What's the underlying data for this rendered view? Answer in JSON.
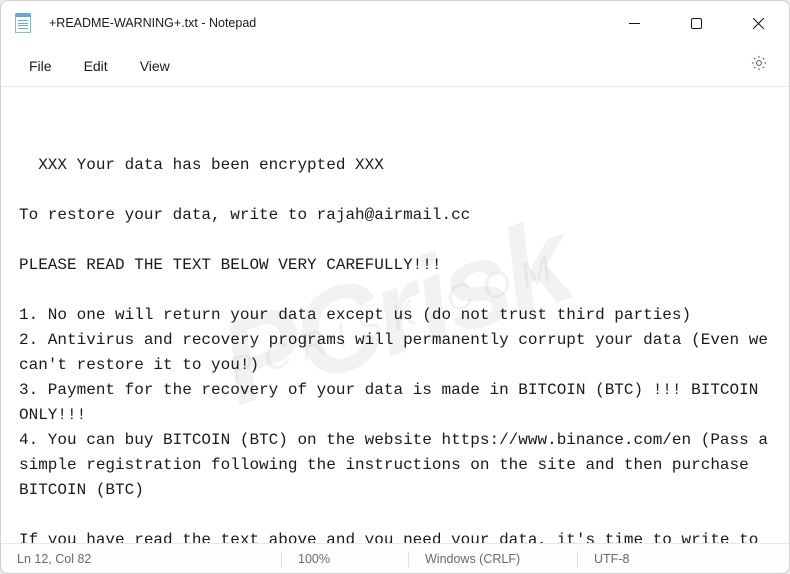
{
  "titlebar": {
    "filename": "+README-WARNING+.txt",
    "appname": "Notepad"
  },
  "menubar": {
    "file": "File",
    "edit": "Edit",
    "view": "View"
  },
  "document": {
    "lines": [
      "XXX Your data has been encrypted XXX",
      "",
      "To restore your data, write to rajah@airmail.cc",
      "",
      "PLEASE READ THE TEXT BELOW VERY CAREFULLY!!!",
      "",
      "1. No one will return your data except us (do not trust third parties)",
      "2. Antivirus and recovery programs will permanently corrupt your data (Even we can't restore it to you!)",
      "3. Payment for the recovery of your data is made in BITCOIN (BTC) !!! BITCOIN ONLY!!!",
      "4. You can buy BITCOIN (BTC) on the website https://www.binance.com/en (Pass a simple registration following the instructions on the site and then purchase BITCOIN (BTC)",
      "",
      "If you have read the text above and you need your data, it's time to write to us."
    ]
  },
  "statusbar": {
    "cursor": "Ln 12, Col 82",
    "zoom": "100%",
    "lineending": "Windows (CRLF)",
    "encoding": "UTF-8"
  },
  "watermark": {
    "main": "PCrisk",
    "sub": "PCRISK.COM"
  }
}
